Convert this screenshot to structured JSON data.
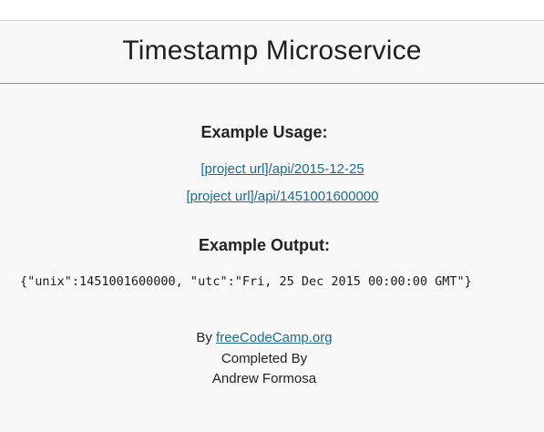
{
  "header": {
    "title": "Timestamp Microservice"
  },
  "usage": {
    "title": "Example Usage:",
    "links": [
      "[project url]/api/2015-12-25",
      "[project url]/api/1451001600000"
    ]
  },
  "output": {
    "title": "Example Output:",
    "code": "{\"unix\":1451001600000, \"utc\":\"Fri, 25 Dec 2015 00:00:00 GMT\"}"
  },
  "footer": {
    "by_prefix": "By ",
    "by_link": "freeCodeCamp.org",
    "completed_by": "Completed By",
    "author": "Andrew Formosa"
  },
  "colors": {
    "link": "#1e6b8f",
    "background": "#f8f8f8"
  }
}
